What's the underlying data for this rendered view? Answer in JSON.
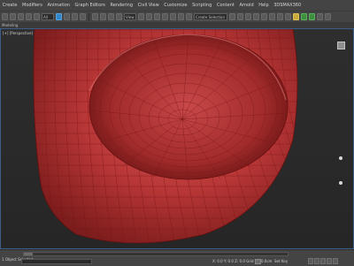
{
  "menus": [
    "Create",
    "Modifiers",
    "Animation",
    "Graph Editors",
    "Rendering",
    "Civil View",
    "Customize",
    "Scripting",
    "Content",
    "Arnold",
    "Help",
    "3DSMAX360"
  ],
  "toolbar": {
    "selection_filter": "All",
    "named_selection": "Create Selection Set",
    "view_mode": "View"
  },
  "ribbon": {
    "label": "Modeling"
  },
  "viewport": {
    "label": "[+] [Perspective] [Standard] [Default Shading]",
    "mesh_color": "#c43d3d",
    "wire_color": "#7a1616"
  },
  "status": {
    "selected": "1 Object Selected",
    "coords": "X: 0.0  Y: 0.0  Z: 0.0  Grid = 10.0cm",
    "autokey": "Set Key",
    "frame": "0 / 100"
  }
}
